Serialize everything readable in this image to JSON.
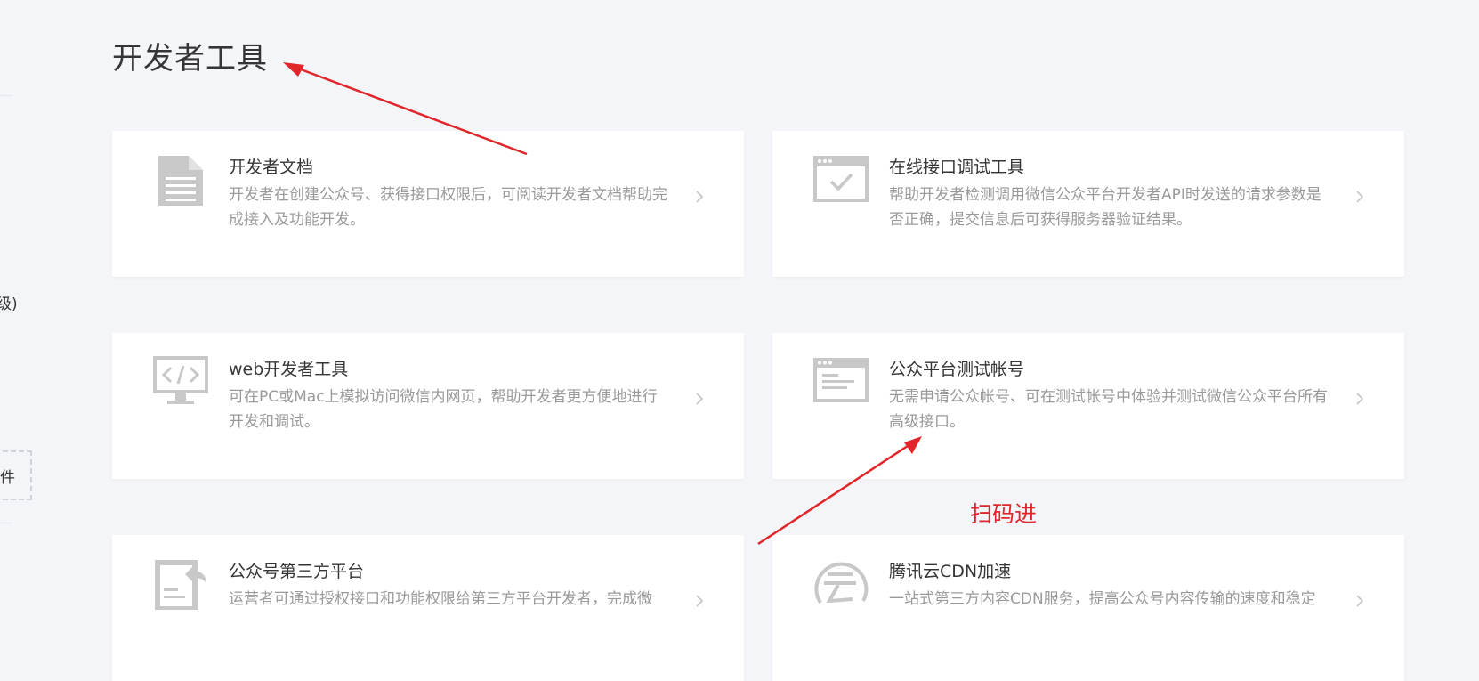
{
  "sidebar": {
    "fragment_1": "级)",
    "fragment_2": "件"
  },
  "page": {
    "title": "开发者工具"
  },
  "cards": [
    {
      "title": "开发者文档",
      "desc": "开发者在创建公众号、获得接口权限后，可阅读开发者文档帮助完成接入及功能开发。",
      "icon": "document-icon"
    },
    {
      "title": "在线接口调试工具",
      "desc": "帮助开发者检测调用微信公众平台开发者API时发送的请求参数是否正确，提交信息后可获得服务器验证结果。",
      "icon": "api-debug-window-icon"
    },
    {
      "title": "web开发者工具",
      "desc": "可在PC或Mac上模拟访问微信内网页，帮助开发者更方便地进行开发和调试。",
      "icon": "code-monitor-icon"
    },
    {
      "title": "公众平台测试帐号",
      "desc": "无需申请公众帐号、可在测试帐号中体验并测试微信公众平台所有高级接口。",
      "icon": "test-account-window-icon"
    },
    {
      "title": "公众号第三方平台",
      "desc": "运营者可通过授权接口和功能权限给第三方平台开发者，完成微",
      "icon": "third-party-platform-icon"
    },
    {
      "title": "腾讯云CDN加速",
      "desc": "一站式第三方内容CDN服务，提高公众号内容传输的速度和稳定",
      "icon": "tencent-cloud-icon"
    }
  ],
  "annotations": {
    "scan_label": "扫码进"
  },
  "colors": {
    "annotation_red": "#e0262a",
    "icon_gray": "#bbbbbb",
    "background": "#f4f5f9"
  }
}
